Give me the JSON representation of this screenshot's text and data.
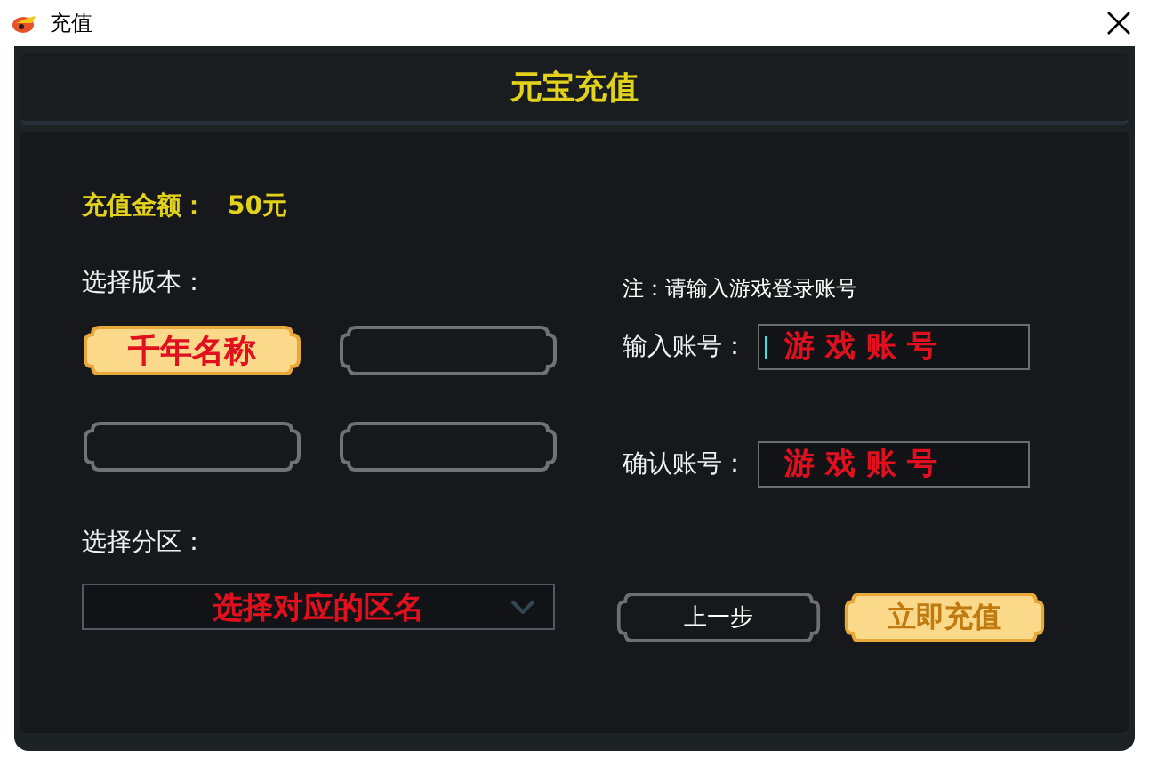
{
  "window": {
    "title": "充值"
  },
  "header": {
    "title": "元宝充值"
  },
  "amount": {
    "label": "充值金额：",
    "value": "50元"
  },
  "version": {
    "label": "选择版本：",
    "options": [
      {
        "label": "千年名称",
        "selected": true
      },
      {
        "selected": false
      },
      {
        "selected": false
      },
      {
        "selected": false
      }
    ]
  },
  "note": "注：请输入游戏登录账号",
  "account_fields": [
    {
      "label": "输入账号：",
      "placeholder": "游 戏 账 号",
      "focused": true
    },
    {
      "label": "确认账号：",
      "placeholder": "游 戏 账 号",
      "focused": false
    }
  ],
  "zone": {
    "label": "选择分区：",
    "placeholder": "选择对应的区名"
  },
  "buttons": [
    {
      "label": "上一步",
      "kind": "secondary"
    },
    {
      "label": "立即充值",
      "kind": "primary"
    }
  ]
}
